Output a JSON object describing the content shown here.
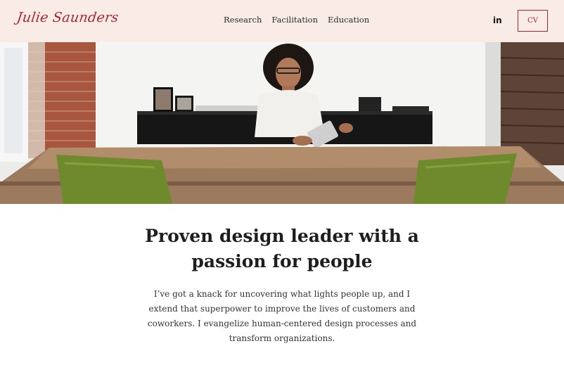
{
  "header": {
    "logo": "Julie Saunders",
    "nav": [
      "Research",
      "Facilitation",
      "Education"
    ],
    "linkedin_label": "in",
    "cv_label": "CV"
  },
  "hero": {
    "image_icon": "hero-photo"
  },
  "main": {
    "headline_line1": "Proven design leader with a",
    "headline_line2": "passion for people",
    "intro": "I’ve got a knack for uncovering what lights people up, and I extend that superpower to improve the lives of customers and coworkers. I evangelize human-centered design processes and transform organizations."
  },
  "colors": {
    "header_bg": "#f9ece7",
    "accent": "#b0242f"
  }
}
